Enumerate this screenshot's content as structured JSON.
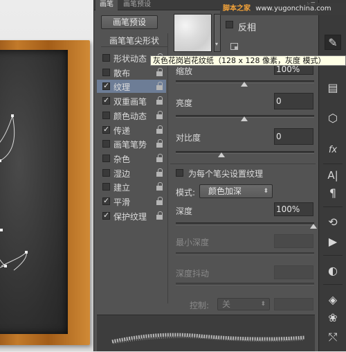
{
  "panel": {
    "tabs": [
      "画笔",
      "画笔预设"
    ],
    "preset_button": "画笔预设",
    "tip_shape_label": "画笔笔尖形状",
    "options": [
      {
        "label": "形状动态",
        "checked": false,
        "selected": false
      },
      {
        "label": "散布",
        "checked": false,
        "selected": false
      },
      {
        "label": "纹理",
        "checked": true,
        "selected": true
      },
      {
        "label": "双重画笔",
        "checked": true,
        "selected": false
      },
      {
        "label": "颜色动态",
        "checked": false,
        "selected": false
      },
      {
        "label": "传递",
        "checked": true,
        "selected": false
      },
      {
        "label": "画笔笔势",
        "checked": false,
        "selected": false
      },
      {
        "label": "杂色",
        "checked": false,
        "selected": false
      },
      {
        "label": "湿边",
        "checked": false,
        "selected": false
      },
      {
        "label": "建立",
        "checked": false,
        "selected": false
      },
      {
        "label": "平滑",
        "checked": true,
        "selected": false
      },
      {
        "label": "保护纹理",
        "checked": true,
        "selected": false
      }
    ]
  },
  "texture": {
    "invert_label": "反相",
    "invert_checked": false,
    "tooltip": "灰色花岗岩花纹纸（128 x 128 像素，灰度 模式）",
    "scale_label": "缩放",
    "scale_value": "100%",
    "brightness_label": "亮度",
    "brightness_value": "0",
    "contrast_label": "对比度",
    "contrast_value": "0",
    "each_tip_label": "为每个笔尖设置纹理",
    "each_tip_checked": false,
    "mode_label": "模式:",
    "mode_value": "颜色加深",
    "depth_label": "深度",
    "depth_value": "100%",
    "min_depth_label": "最小深度",
    "depth_jitter_label": "深度抖动",
    "control_label": "控制:",
    "control_value": "关"
  },
  "watermark": {
    "logo": "脚本之家",
    "url": "www.yugonchina.com"
  },
  "toolbar": {
    "icons": [
      "brush-panel-icon",
      "brush-presets-icon",
      "3d-cube-icon",
      "fx-icon",
      "character-icon",
      "paragraph-icon",
      "history-icon",
      "actions-play-icon",
      "adjustments-icon",
      "layers-icon",
      "channels-icon",
      "paths-icon"
    ]
  }
}
